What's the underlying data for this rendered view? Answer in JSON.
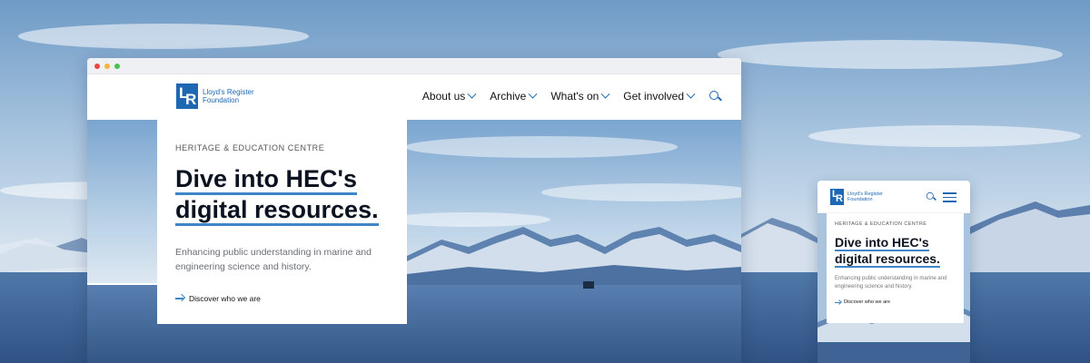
{
  "desktop": {
    "logo_text": "Lloyd's Register Foundation",
    "logo_letters": {
      "l": "L",
      "r": "R"
    },
    "nav": [
      {
        "label": "About us"
      },
      {
        "label": "Archive"
      },
      {
        "label": "What's on"
      },
      {
        "label": "Get involved"
      }
    ],
    "hero": {
      "eyebrow": "HERITAGE & EDUCATION CENTRE",
      "headline_line1": "Dive into HEC's",
      "headline_line2": "digital resources.",
      "lede": "Enhancing public understanding in marine and engineering science and history.",
      "cta": "Discover who we are"
    }
  },
  "mobile": {
    "logo_text": "Lloyd's Register Foundation",
    "hero": {
      "eyebrow": "HERITAGE & EDUCATION CENTRE",
      "headline_line1": "Dive into HEC's",
      "headline_line2": "digital resources.",
      "lede": "Enhancing public understanding in marine and engineering science and history.",
      "cta": "Discover who we are"
    }
  },
  "colors": {
    "brand_blue": "#1e67b3",
    "accent_blue": "#3f86c8",
    "text_dark": "#0c1320"
  },
  "icons": [
    "search-icon",
    "chevron-down-icon",
    "menu-icon",
    "arrow-right-icon"
  ]
}
